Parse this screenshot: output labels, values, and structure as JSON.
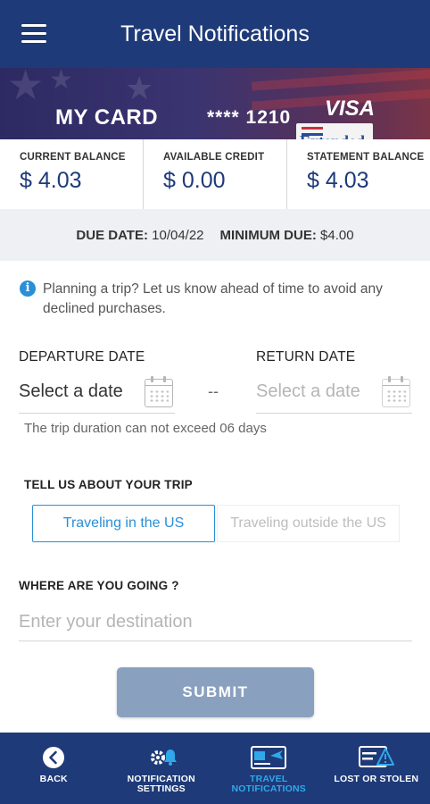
{
  "header": {
    "title": "Travel Notifications"
  },
  "card": {
    "name": "MY CARD",
    "number_masked": "**** 1210",
    "brand": "VISA",
    "sticker_text": "Extended"
  },
  "balances": [
    {
      "label": "CURRENT BALANCE",
      "value": "$ 4.03"
    },
    {
      "label": "AVAILABLE CREDIT",
      "value": "$ 0.00"
    },
    {
      "label": "STATEMENT BALANCE",
      "value": "$ 4.03"
    }
  ],
  "due": {
    "due_date_label": "DUE DATE:",
    "due_date": "10/04/22",
    "min_due_label": "MINIMUM DUE:",
    "min_due": "$4.00"
  },
  "info": {
    "text": "Planning a trip? Let us know ahead of time to avoid any declined purchases."
  },
  "form": {
    "departure_label": "DEPARTURE DATE",
    "departure_placeholder": "Select a date",
    "return_label": "RETURN DATE",
    "return_placeholder": "Select a date",
    "separator": "--",
    "duration_note": "The trip duration can not exceed 06 days",
    "trip_label": "TELL US ABOUT YOUR TRIP",
    "trip_options": [
      "Traveling in the US",
      "Traveling outside the US"
    ],
    "selected_trip": "Traveling in the US",
    "where_label": "WHERE ARE YOU GOING ?",
    "destination_placeholder": "Enter your destination",
    "destination_value": "",
    "submit_label": "SUBMIT"
  },
  "bottom_nav": [
    {
      "label": "BACK",
      "icon": "back-arrow-icon",
      "active": false
    },
    {
      "label": "NOTIFICATION SETTINGS",
      "icon": "notification-settings-icon",
      "active": false
    },
    {
      "label": "TRAVEL NOTIFICATIONS",
      "icon": "travel-card-icon",
      "active": true
    },
    {
      "label": "LOST OR STOLEN",
      "icon": "card-alert-icon",
      "active": false
    }
  ],
  "colors": {
    "primary": "#1e3a78",
    "accent": "#2a8fd6",
    "active_nav": "#2fa8ea",
    "submit_disabled": "#8aa0bf"
  }
}
